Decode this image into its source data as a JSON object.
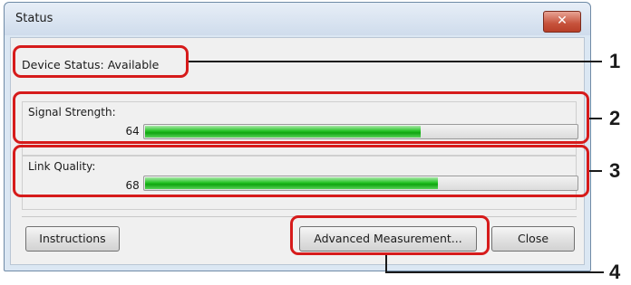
{
  "window": {
    "title": "Status",
    "close_symbol": "✕"
  },
  "device_status": {
    "label": "Device Status:",
    "value": "Available",
    "text": "Device Status: Available"
  },
  "signal": {
    "label": "Signal Strength:",
    "value_text": "64 %",
    "percent": 64
  },
  "link": {
    "label": "Link Quality:",
    "value_text": "68 %",
    "percent": 68
  },
  "buttons": {
    "instructions": "Instructions",
    "advanced": "Advanced Measurement...",
    "close": "Close"
  },
  "callouts": [
    "1",
    "2",
    "3",
    "4"
  ],
  "colors": {
    "callout": "#d61b1b",
    "bar_fill": "#1fbf1f"
  }
}
